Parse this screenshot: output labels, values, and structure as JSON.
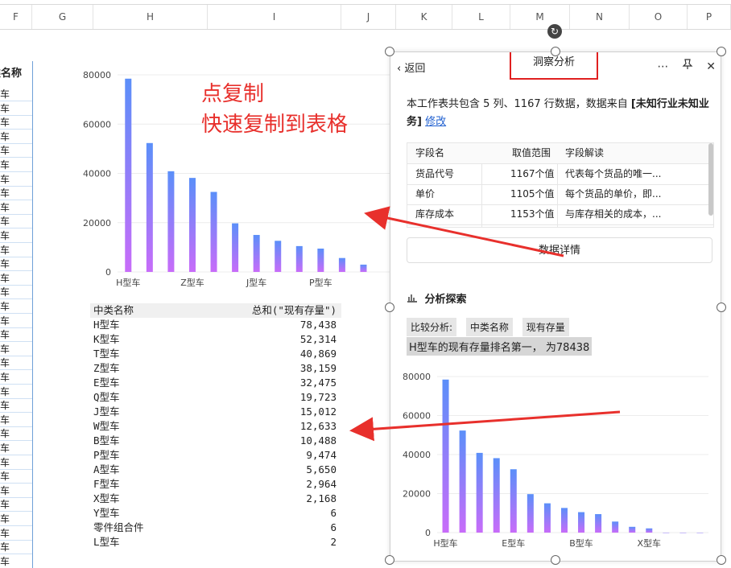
{
  "columns": [
    {
      "letter": "F",
      "left": 0,
      "width": 40
    },
    {
      "letter": "G",
      "left": 40,
      "width": 76
    },
    {
      "letter": "H",
      "left": 116,
      "width": 142
    },
    {
      "letter": "I",
      "left": 258,
      "width": 166
    },
    {
      "letter": "J",
      "left": 424,
      "width": 68
    },
    {
      "letter": "K",
      "left": 492,
      "width": 70
    },
    {
      "letter": "L",
      "left": 562,
      "width": 72
    },
    {
      "letter": "M",
      "left": 634,
      "width": 74
    },
    {
      "letter": "N",
      "left": 708,
      "width": 74
    },
    {
      "letter": "O",
      "left": 782,
      "width": 72
    },
    {
      "letter": "P",
      "left": 854,
      "width": 54
    }
  ],
  "sheet_left_column": {
    "header": "类名称",
    "cell_text": "车",
    "row_count": 34
  },
  "annotation": {
    "line1": "点复制",
    "line2": "快速复制到表格"
  },
  "pivot_table": {
    "header_name": "中类名称",
    "header_value": "总和(\"现有存量\")",
    "rows": [
      {
        "name": "H型车",
        "value": "78,438"
      },
      {
        "name": "K型车",
        "value": "52,314"
      },
      {
        "name": "T型车",
        "value": "40,869"
      },
      {
        "name": "Z型车",
        "value": "38,159"
      },
      {
        "name": "E型车",
        "value": "32,475"
      },
      {
        "name": "Q型车",
        "value": "19,723"
      },
      {
        "name": "J型车",
        "value": "15,012"
      },
      {
        "name": "W型车",
        "value": "12,633"
      },
      {
        "name": "B型车",
        "value": "10,488"
      },
      {
        "name": "P型车",
        "value": "9,474"
      },
      {
        "name": "A型车",
        "value": "5,650"
      },
      {
        "name": "F型车",
        "value": "2,964"
      },
      {
        "name": "X型车",
        "value": "2,168"
      },
      {
        "name": "Y型车",
        "value": "6"
      },
      {
        "name": "零件组合件",
        "value": "6"
      },
      {
        "name": "L型车",
        "value": "2"
      }
    ]
  },
  "chart_data": [
    {
      "type": "bar",
      "title": "",
      "categories": [
        "H型车",
        "K型车",
        "T型车",
        "Z型车",
        "E型车",
        "Q型车",
        "J型车",
        "W型车",
        "B型车",
        "P型车",
        "A型车",
        "F型车"
      ],
      "values": [
        78438,
        52314,
        40869,
        38159,
        32475,
        19723,
        15012,
        12633,
        10488,
        9474,
        5650,
        2964
      ],
      "xtick_labels": [
        "H型车",
        "Z型车",
        "J型车",
        "P型车"
      ],
      "ylim": [
        0,
        80000
      ],
      "yticks": [
        0,
        20000,
        40000,
        60000,
        80000
      ],
      "grid": true,
      "gradient": [
        "#5b8ff9",
        "#c86cf9"
      ]
    },
    {
      "type": "bar",
      "title": "",
      "categories": [
        "H型车",
        "K型车",
        "T型车",
        "Z型车",
        "E型车",
        "Q型车",
        "J型车",
        "W型车",
        "B型车",
        "P型车",
        "A型车",
        "F型车",
        "X型车",
        "Y型车",
        "零件组合件",
        "L型车"
      ],
      "values": [
        78438,
        52314,
        40869,
        38159,
        32475,
        19723,
        15012,
        12633,
        10488,
        9474,
        5650,
        2964,
        2168,
        6,
        6,
        2
      ],
      "xtick_labels": [
        "H型车",
        "E型车",
        "B型车",
        "X型车"
      ],
      "ylim": [
        0,
        80000
      ],
      "yticks": [
        0,
        20000,
        40000,
        60000,
        80000
      ],
      "grid": true,
      "gradient": [
        "#5b8ff9",
        "#c86cf9"
      ]
    }
  ],
  "panel": {
    "back_label": "返回",
    "title": "洞察分析",
    "more_icon": "more-dots-icon",
    "pin_icon": "pin-icon",
    "close_icon": "close-icon",
    "desc_prefix": "本工作表共包含 5 列、1167 行数据，数据来自",
    "desc_source": "[未知行业未知业务]",
    "desc_edit": "修改",
    "field_table": {
      "headers": [
        "字段名",
        "取值范围",
        "字段解读"
      ],
      "rows": [
        [
          "货品代号",
          "1167个值",
          "代表每个货品的唯一..."
        ],
        [
          "单价",
          "1105个值",
          "每个货品的单价，即..."
        ],
        [
          "库存成本",
          "1153个值",
          "与库存相关的成本，..."
        ]
      ]
    },
    "detail_button": "数据详情",
    "explore_title": "分析探索",
    "compare_label": "比较分析:",
    "compare_tags": [
      "中类名称",
      "现有存量"
    ],
    "insight": "H型车的现有存量排名第一，   为78438"
  },
  "colors": {
    "annotation": "#e8302c",
    "highlight_box": "#e02020",
    "link": "#2060d0"
  }
}
